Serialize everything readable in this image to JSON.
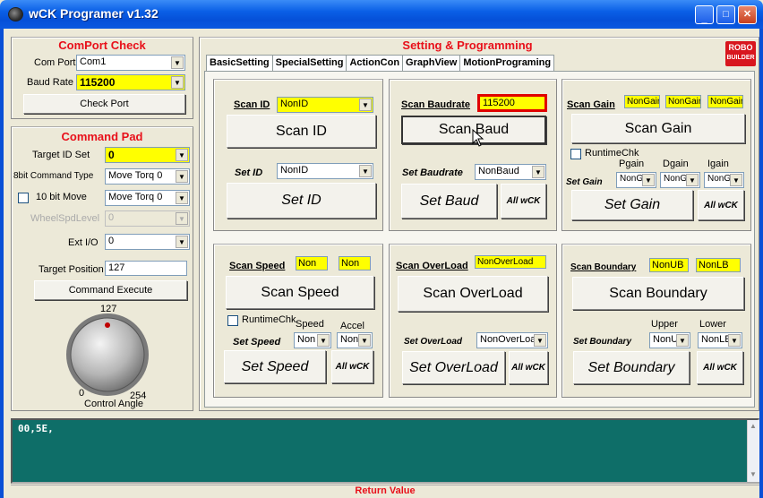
{
  "window": {
    "title": "wCK Programer v1.32"
  },
  "comport": {
    "title": "ComPort Check",
    "port_label": "Com Port",
    "port_value": "Com1",
    "baud_label": "Baud Rate",
    "baud_value": "115200",
    "check_button": "Check Port"
  },
  "cmdpad": {
    "title": "Command Pad",
    "target_id_label": "Target ID Set",
    "target_id_value": "0",
    "cmd8_label": "8bit Command Type",
    "cmd8_value": "Move Torq 0",
    "move10_label": "10 bit Move",
    "move10_value": "Move Torq 0",
    "wheel_label": "WheelSpdLevel",
    "wheel_value": "0",
    "extio_label": "Ext I/O",
    "extio_value": "0",
    "targetpos_label": "Target Position",
    "targetpos_value": "127",
    "execute_button": "Command Execute",
    "knob_top": "127",
    "knob_min": "0",
    "knob_max": "254",
    "knob_label": "Control Angle",
    "knob_fraction": 0.5
  },
  "setting": {
    "title": "Setting & Programming",
    "tabs": [
      "BasicSetting",
      "SpecialSetting",
      "ActionCon",
      "GraphView",
      "MotionPrograming"
    ],
    "logo_line1": "ROBO",
    "logo_line2": "BUILDER"
  },
  "id": {
    "scan_label": "Scan ID",
    "scan_value": "NonID",
    "scan_button": "Scan ID",
    "set_label": "Set ID",
    "set_value": "NonID",
    "set_button": "Set ID"
  },
  "baud": {
    "scan_label": "Scan Baudrate",
    "scan_value": "115200",
    "scan_button": "Scan Baud",
    "set_label": "Set Baudrate",
    "set_value": "NonBaud",
    "set_button": "Set Baud",
    "all_button": "All wCK"
  },
  "gain": {
    "scan_label": "Scan Gain",
    "v1": "NonGair",
    "v2": "NonGair",
    "v3": "NonGair",
    "scan_button": "Scan Gain",
    "runtime_label": "RuntimeChk",
    "pgain": "Pgain",
    "dgain": "Dgain",
    "igain": "Igain",
    "set_label": "Set Gain",
    "s1": "NonG",
    "s2": "NonG",
    "s3": "NonG",
    "set_button": "Set Gain",
    "all_button": "All wCK"
  },
  "speed": {
    "scan_label": "Scan Speed",
    "v1": "Non",
    "v2": "Non",
    "scan_button": "Scan Speed",
    "runtime_label": "RuntimeChk",
    "speed": "Speed",
    "accel": "Accel",
    "set_label": "Set Speed",
    "s1": "Non",
    "s2": "Non",
    "set_button": "Set Speed",
    "all_button": "All wCK"
  },
  "overload": {
    "scan_label": "Scan OverLoad",
    "scan_value": "NonOverLoad",
    "scan_button": "Scan OverLoad",
    "set_label": "Set OverLoad",
    "set_value": "NonOverLoa",
    "set_button": "Set OverLoad",
    "all_button": "All wCK"
  },
  "boundary": {
    "scan_label": "Scan Boundary",
    "v1": "NonUB",
    "v2": "NonLB",
    "scan_button": "Scan Boundary",
    "upper": "Upper",
    "lower": "Lower",
    "set_label": "Set Boundary",
    "s1": "NonU",
    "s2": "NonLE",
    "set_button": "Set Boundary",
    "all_button": "All wCK"
  },
  "output": {
    "text": "00,5E,"
  },
  "status": {
    "text": "Return Value"
  }
}
